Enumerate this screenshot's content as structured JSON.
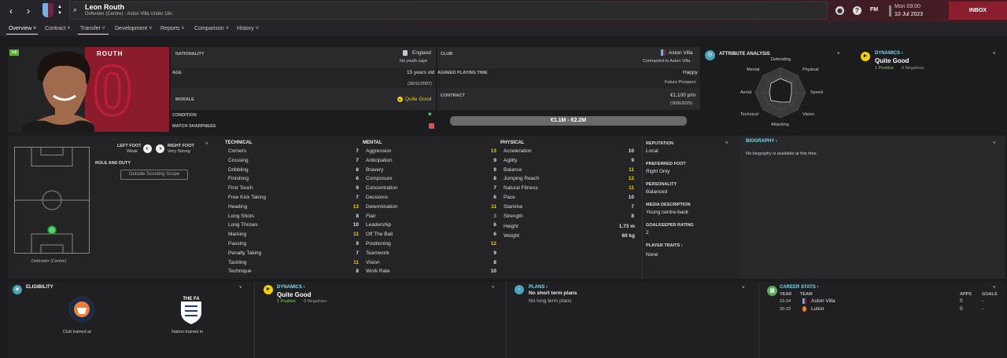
{
  "header": {
    "player_name": "Leon Routh",
    "subtitle": "Defender (Centre) - Aston Villa Under 18s",
    "fm_label": "FM",
    "time": "Mon 09:00",
    "date": "10 Jul 2023",
    "inbox": "INBOX"
  },
  "tabs": [
    "Overview",
    "Contract",
    "Transfer",
    "Development",
    "Reports",
    "Comparison",
    "History"
  ],
  "profile": {
    "badge": "Yth",
    "surname": "ROUTH",
    "squad_number": "0"
  },
  "info": {
    "nationality_label": "NATIONALITY",
    "nationality": "England",
    "youth_caps": "No youth caps",
    "age_label": "AGE",
    "age": "15 years old",
    "dob": "(30/11/2007)",
    "morale_label": "MORALE",
    "morale": "Quite Good",
    "condition_label": "CONDITION",
    "sharpness_label": "MATCH SHARPNESS",
    "club_label": "CLUB",
    "club": "Aston Villa",
    "contracted": "Contracted to Aston Villa",
    "playing_time_label": "AGREED PLAYING TIME",
    "happy": "Happy",
    "future_prospect": "Future Prospect",
    "contract_label": "CONTRACT",
    "wage": "€1,100 p/m",
    "contract_end": "(30/6/2025)",
    "value": "€1.1M - €2.2M"
  },
  "attribute_analysis": {
    "title": "ATTRIBUTE ANALYSIS",
    "labels": [
      "Defending",
      "Physical",
      "Speed",
      "Vision",
      "Attacking",
      "Technical",
      "Aerial",
      "Mental"
    ]
  },
  "dynamics_top": {
    "title": "DYNAMICS",
    "status": "Quite Good",
    "positive": "1 Positive",
    "negative": "0 Negatives"
  },
  "pitch": {
    "left_foot_label": "LEFT FOOT",
    "left_foot": "Weak",
    "right_foot_label": "RIGHT FOOT",
    "right_foot": "Very Strong",
    "role_label": "ROLE AND DUTY",
    "scouting_button": "Outside Scouting Scope",
    "position": "Defender (Centre)"
  },
  "technical": {
    "title": "TECHNICAL",
    "attrs": [
      {
        "name": "Corners",
        "value": "7"
      },
      {
        "name": "Crossing",
        "value": "7"
      },
      {
        "name": "Dribbling",
        "value": "8"
      },
      {
        "name": "Finishing",
        "value": "6"
      },
      {
        "name": "First Touch",
        "value": "9"
      },
      {
        "name": "Free Kick Taking",
        "value": "7"
      },
      {
        "name": "Heading",
        "value": "13"
      },
      {
        "name": "Long Shots",
        "value": "8"
      },
      {
        "name": "Long Throws",
        "value": "10"
      },
      {
        "name": "Marking",
        "value": "11"
      },
      {
        "name": "Passing",
        "value": "9"
      },
      {
        "name": "Penalty Taking",
        "value": "7"
      },
      {
        "name": "Tackling",
        "value": "11"
      },
      {
        "name": "Technique",
        "value": "8"
      }
    ]
  },
  "mental": {
    "title": "MENTAL",
    "attrs": [
      {
        "name": "Aggression",
        "value": "13"
      },
      {
        "name": "Anticipation",
        "value": "9"
      },
      {
        "name": "Bravery",
        "value": "9"
      },
      {
        "name": "Composure",
        "value": "8"
      },
      {
        "name": "Concentration",
        "value": "7"
      },
      {
        "name": "Decisions",
        "value": "6"
      },
      {
        "name": "Determination",
        "value": "11"
      },
      {
        "name": "Flair",
        "value": "3"
      },
      {
        "name": "Leadership",
        "value": "6"
      },
      {
        "name": "Off The Ball",
        "value": "6"
      },
      {
        "name": "Positioning",
        "value": "12"
      },
      {
        "name": "Teamwork",
        "value": "9"
      },
      {
        "name": "Vision",
        "value": "8"
      },
      {
        "name": "Work Rate",
        "value": "10"
      }
    ]
  },
  "physical": {
    "title": "PHYSICAL",
    "attrs": [
      {
        "name": "Acceleration",
        "value": "10"
      },
      {
        "name": "Agility",
        "value": "9"
      },
      {
        "name": "Balance",
        "value": "11"
      },
      {
        "name": "Jumping Reach",
        "value": "12"
      },
      {
        "name": "Natural Fitness",
        "value": "11"
      },
      {
        "name": "Pace",
        "value": "10"
      },
      {
        "name": "Stamina",
        "value": "7"
      },
      {
        "name": "Strength",
        "value": "8"
      }
    ],
    "height_label": "Height",
    "height": "1.73 m",
    "weight_label": "Weight",
    "weight": "60 kg"
  },
  "details": {
    "reputation_label": "REPUTATION",
    "reputation": "Local",
    "preferred_foot_label": "PREFERRED FOOT",
    "preferred_foot": "Right Only",
    "personality_label": "PERSONALITY",
    "personality": "Balanced",
    "media_label": "MEDIA DESCRIPTION",
    "media": "Young centre-back",
    "gk_label": "GOALKEEPER RATING",
    "gk": "2",
    "traits_label": "PLAYER TRAITS",
    "traits": "None"
  },
  "biography": {
    "title": "BIOGRAPHY",
    "text": "No biography is available at this time."
  },
  "eligibility": {
    "title": "ELIGIBILITY",
    "club_trained": "Club trained at",
    "nation_trained": "Nation trained in",
    "fa_label": "THE FA"
  },
  "dynamics_bottom": {
    "title": "DYNAMICS",
    "status": "Quite Good",
    "positive": "1 Positive",
    "negative": "0 Negatives"
  },
  "plans": {
    "title": "PLANS",
    "short": "No short term plans",
    "long": "No long term plans"
  },
  "career": {
    "title": "CAREER STATS",
    "year_h": "YEAR",
    "team_h": "TEAM",
    "apps_h": "APPS",
    "goals_h": "GOALS",
    "rows": [
      {
        "year": "23-24",
        "team": "Aston Villa",
        "apps": "0",
        "goals": "-"
      },
      {
        "year": "20-23",
        "team": "Luton",
        "apps": "0",
        "goals": "-"
      }
    ]
  }
}
